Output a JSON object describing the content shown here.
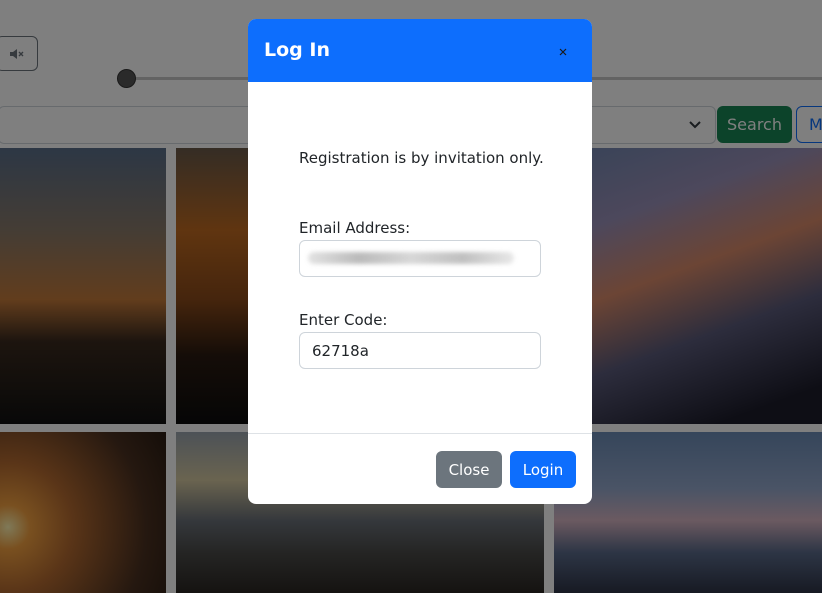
{
  "background": {
    "mute_icon": "speaker-muted-icon",
    "search_button_label": "Search",
    "more_button_label": "M",
    "select_icon": "chevron-down-icon",
    "photos": [
      "sunset-photo",
      "sunset-photo",
      "sunset-photo",
      "sunset-photo",
      "beach-photo",
      "mountain-photo"
    ]
  },
  "modal": {
    "title": "Log In",
    "close_icon": "close-icon",
    "info_text": "Registration is by invitation only.",
    "email_label": "Email Address:",
    "email_value": "",
    "code_label": "Enter Code:",
    "code_value": "62718a",
    "close_button_label": "Close",
    "login_button_label": "Login"
  },
  "colors": {
    "primary": "#0d6efd",
    "success": "#198754",
    "secondary": "#6c757d"
  }
}
